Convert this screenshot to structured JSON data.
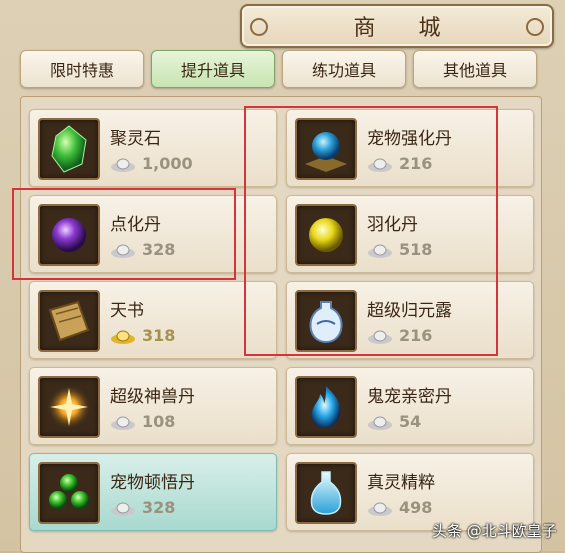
{
  "title": "商  城",
  "tabs": [
    {
      "label": "限时特惠",
      "active": false
    },
    {
      "label": "提升道具",
      "active": true
    },
    {
      "label": "练功道具",
      "active": false
    },
    {
      "label": "其他道具",
      "active": false
    }
  ],
  "items": [
    {
      "name": "聚灵石",
      "price": "1,000",
      "currency": "silver-ingot",
      "icon": "green-crystal-icon"
    },
    {
      "name": "宠物强化丹",
      "price": "216",
      "currency": "silver-ingot",
      "icon": "blue-orb-icon"
    },
    {
      "name": "点化丹",
      "price": "328",
      "currency": "silver-ingot",
      "icon": "purple-pearl-icon"
    },
    {
      "name": "羽化丹",
      "price": "518",
      "currency": "silver-ingot",
      "icon": "yellow-orb-icon"
    },
    {
      "name": "天书",
      "price": "318",
      "currency": "gold-ingot",
      "icon": "book-icon"
    },
    {
      "name": "超级归元露",
      "price": "216",
      "currency": "silver-ingot",
      "icon": "vase-icon"
    },
    {
      "name": "超级神兽丹",
      "price": "108",
      "currency": "silver-ingot",
      "icon": "sparkle-icon"
    },
    {
      "name": "鬼宠亲密丹",
      "price": "54",
      "currency": "silver-ingot",
      "icon": "blue-flame-icon"
    },
    {
      "name": "宠物顿悟丹",
      "price": "328",
      "currency": "silver-ingot",
      "icon": "green-pills-icon",
      "highlighted": true
    },
    {
      "name": "真灵精粹",
      "price": "498",
      "currency": "silver-ingot",
      "icon": "essence-bottle-icon"
    }
  ],
  "colors": {
    "highlight_box": "#d6343b",
    "active_tab": "#c7e5b2"
  },
  "watermark": "头条 @北斗欧皇子"
}
